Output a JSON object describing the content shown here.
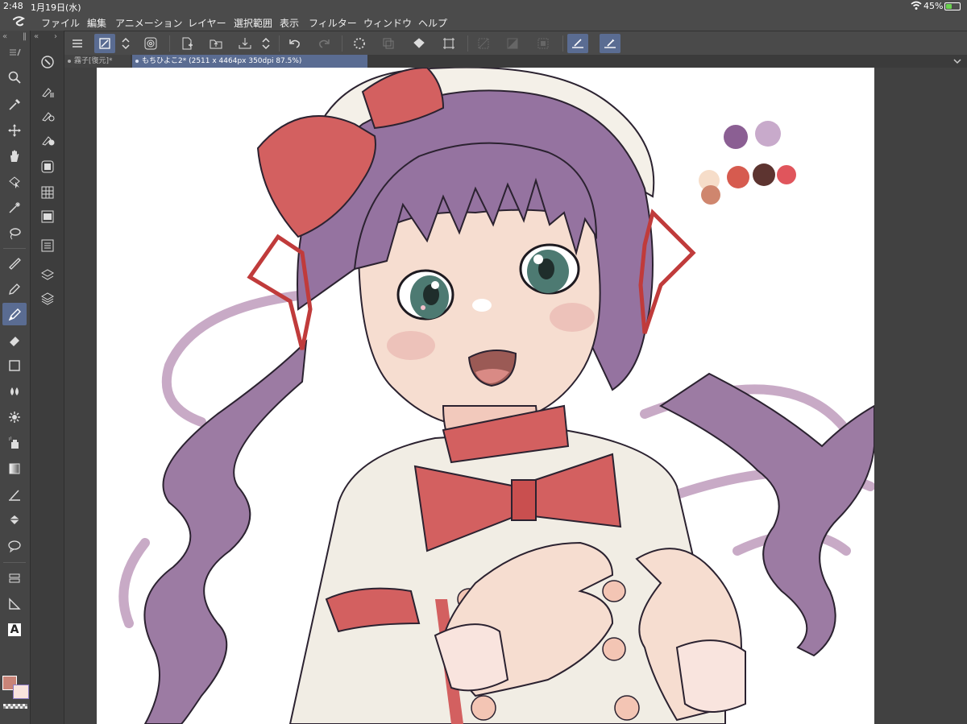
{
  "status_bar": {
    "time": "2:48",
    "date": "1月19日(水)",
    "battery_percent": "45%",
    "battery_level": 0.45,
    "battery_color": "#6ad24f"
  },
  "menu_bar": {
    "items": [
      "ファイル",
      "編集",
      "アニメーション",
      "レイヤー",
      "選択範囲",
      "表示",
      "フィルター",
      "ウィンドウ",
      "ヘルプ"
    ]
  },
  "command_bar": {
    "buttons": [
      "menu-icon",
      "transform-icon",
      "stepper-icon",
      "lasso-swirl-icon",
      "new-file-icon",
      "open-file-icon",
      "save-icon",
      "undo-icon",
      "redo-icon",
      "loading-icon",
      "copy-layer-icon",
      "fill-icon",
      "canvas-size-icon",
      "hide-selection-icon",
      "clear-icon",
      "invert-icon",
      "ruler-pen-icon",
      "ruler-snap-icon"
    ]
  },
  "tabs": [
    {
      "label": "霧子[復元]*",
      "active": false
    },
    {
      "label": "もちひよこ2* (2511 x 4464px 350dpi 87.5%)",
      "active": true
    }
  ],
  "tool_palette": {
    "tools": [
      "zoom-icon",
      "eyedropper-icon",
      "move-icon",
      "hand-icon",
      "object-select-icon",
      "auto-select-icon",
      "lasso-icon",
      "pen-icon",
      "pencil-icon",
      "brush-icon",
      "eraser-icon",
      "rectangle-icon",
      "blend-icon",
      "decoration-icon",
      "airbrush-icon",
      "gradient-icon",
      "ruler-icon",
      "fill-bucket-icon",
      "balloon-icon",
      "frame-border-icon",
      "perspective-icon",
      "text-icon"
    ],
    "active_tool": "brush-icon",
    "main_color": "#c98478",
    "sub_color": "#f9e4de",
    "text_tool_label": "A"
  },
  "sub_palette": {
    "buttons": [
      "sub-tool-icon",
      "tool-property-icon",
      "brush-size-icon",
      "color-wheel-icon",
      "color-set-icon",
      "intermediate-color-icon",
      "color-history-icon",
      "layer-property-icon",
      "layers-icon"
    ]
  },
  "canvas": {
    "background": "#ffffff",
    "palette_swatches": [
      "#8b5f93",
      "#c8aacb",
      "#f6ddc9",
      "#d65b4f",
      "#5d3430",
      "#e0555c",
      "#cf866e"
    ],
    "subject": "girl-with-purple-twintails-and-red-bow"
  }
}
